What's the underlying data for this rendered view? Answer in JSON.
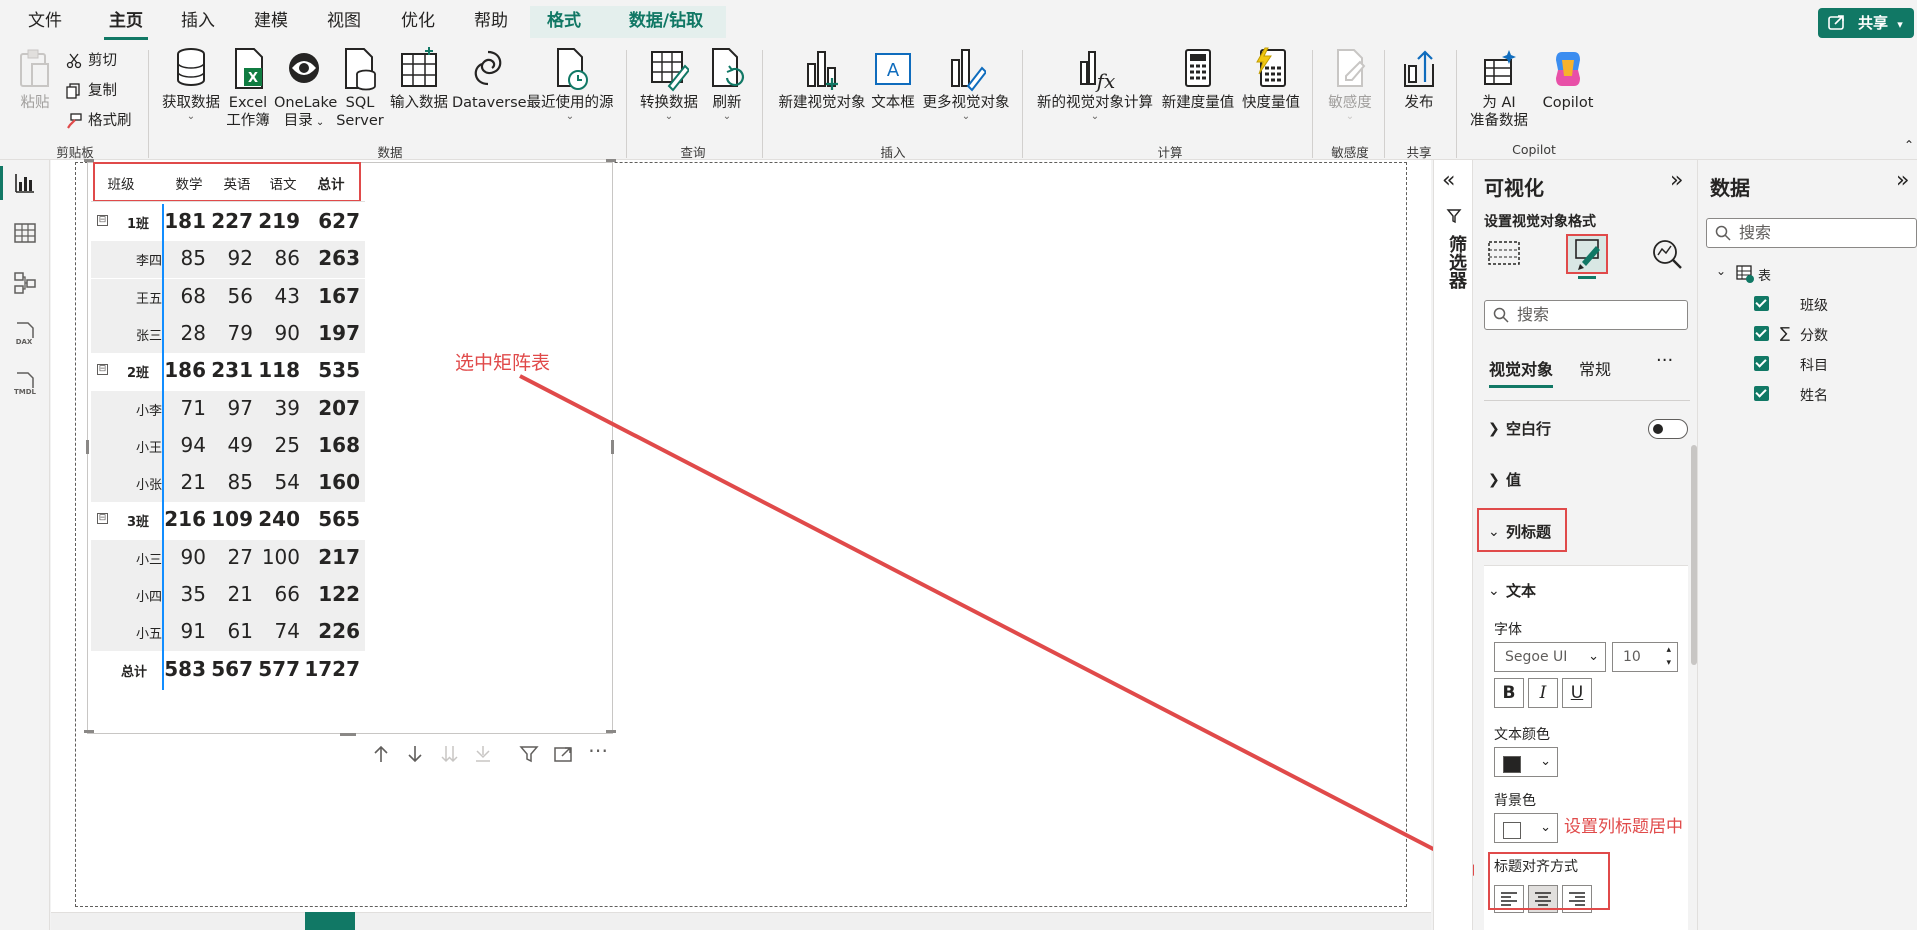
{
  "menu": {
    "tabs": [
      "文件",
      "主页",
      "插入",
      "建模",
      "视图",
      "优化",
      "帮助",
      "格式",
      "数据/钻取"
    ],
    "active": "主页",
    "share": "共享"
  },
  "ribbon": {
    "paste": "粘贴",
    "cut": "剪切",
    "copy": "复制",
    "format_painter": "格式刷",
    "get_data": "获取数据",
    "excel_line1": "Excel",
    "excel_line2": "工作簿",
    "onelake_line1": "OneLake",
    "onelake_line2": "目录",
    "sql_line1": "SQL",
    "sql_line2": "Server",
    "enter_data": "输入数据",
    "dataverse": "Dataverse",
    "recent_sources": "最近使用的源",
    "transform": "转换数据",
    "refresh": "刷新",
    "new_visual": "新建视觉对象",
    "text_box": "文本框",
    "more_visuals": "更多视觉对象",
    "new_visual_calc": "新的视觉对象计算",
    "new_measure": "新建度量值",
    "quick_measure": "快度量值",
    "sensitivity": "敏感度",
    "publish": "发布",
    "ai_line1": "为 AI",
    "ai_line2": "准备数据",
    "copilot": "Copilot",
    "groups": {
      "clipboard": "剪贴板",
      "data": "数据",
      "query": "查询",
      "insert": "插入",
      "calc": "计算",
      "sensitivity": "敏感度",
      "share": "共享",
      "copilot": "Copilot"
    }
  },
  "matrix": {
    "headers": [
      "班级",
      "数学",
      "英语",
      "语文",
      "总计"
    ],
    "rows": [
      {
        "label": "1班",
        "type": "group",
        "values": [
          "181",
          "227",
          "219",
          "627"
        ]
      },
      {
        "label": "李四",
        "type": "leaf",
        "values": [
          "85",
          "92",
          "86",
          "263"
        ]
      },
      {
        "label": "王五",
        "type": "leaf",
        "values": [
          "68",
          "56",
          "43",
          "167"
        ]
      },
      {
        "label": "张三",
        "type": "leaf",
        "values": [
          "28",
          "79",
          "90",
          "197"
        ]
      },
      {
        "label": "2班",
        "type": "group",
        "values": [
          "186",
          "231",
          "118",
          "535"
        ]
      },
      {
        "label": "小李",
        "type": "leaf",
        "values": [
          "71",
          "97",
          "39",
          "207"
        ]
      },
      {
        "label": "小王",
        "type": "leaf",
        "values": [
          "94",
          "49",
          "25",
          "168"
        ]
      },
      {
        "label": "小张",
        "type": "leaf",
        "values": [
          "21",
          "85",
          "54",
          "160"
        ]
      },
      {
        "label": "3班",
        "type": "group",
        "values": [
          "216",
          "109",
          "240",
          "565"
        ]
      },
      {
        "label": "小三",
        "type": "leaf",
        "values": [
          "90",
          "27",
          "100",
          "217"
        ]
      },
      {
        "label": "小四",
        "type": "leaf",
        "values": [
          "35",
          "21",
          "66",
          "122"
        ]
      },
      {
        "label": "小五",
        "type": "leaf",
        "values": [
          "91",
          "61",
          "74",
          "226"
        ]
      },
      {
        "label": "总计",
        "type": "total",
        "values": [
          "583",
          "567",
          "577",
          "1727"
        ]
      }
    ],
    "collapse_glyph": "⊟"
  },
  "annotations": {
    "select_matrix": "选中矩阵表",
    "set_center": "设置列标题居中"
  },
  "filters": {
    "label": "筛选器"
  },
  "viz": {
    "title": "可视化",
    "subtitle": "设置视觉对象格式",
    "search_placeholder": "搜索",
    "tab_visual": "视觉对象",
    "tab_general": "常规",
    "more": "···",
    "sections": {
      "blank_rows": "空白行",
      "values": "值",
      "column_headers": "列标题",
      "text": "文本"
    },
    "font_label": "字体",
    "font_value": "Segoe UI",
    "font_size": "10",
    "bold": "B",
    "italic": "I",
    "underline": "U",
    "text_color_label": "文本颜色",
    "text_color": "#252423",
    "bg_color_label": "背景色",
    "bg_color": "#ffffff",
    "alignment_label": "标题对齐方式",
    "alignment_selected": "center"
  },
  "data_pane": {
    "title": "数据",
    "search_placeholder": "搜索",
    "table": "表",
    "fields": [
      {
        "name": "班级",
        "sigma": false
      },
      {
        "name": "分数",
        "sigma": true
      },
      {
        "name": "科目",
        "sigma": false
      },
      {
        "name": "姓名",
        "sigma": false
      }
    ],
    "sigma_glyph": "∑"
  },
  "colors": {
    "accent": "#117865",
    "annotation": "#e04a4a",
    "selection": "#118dff"
  }
}
